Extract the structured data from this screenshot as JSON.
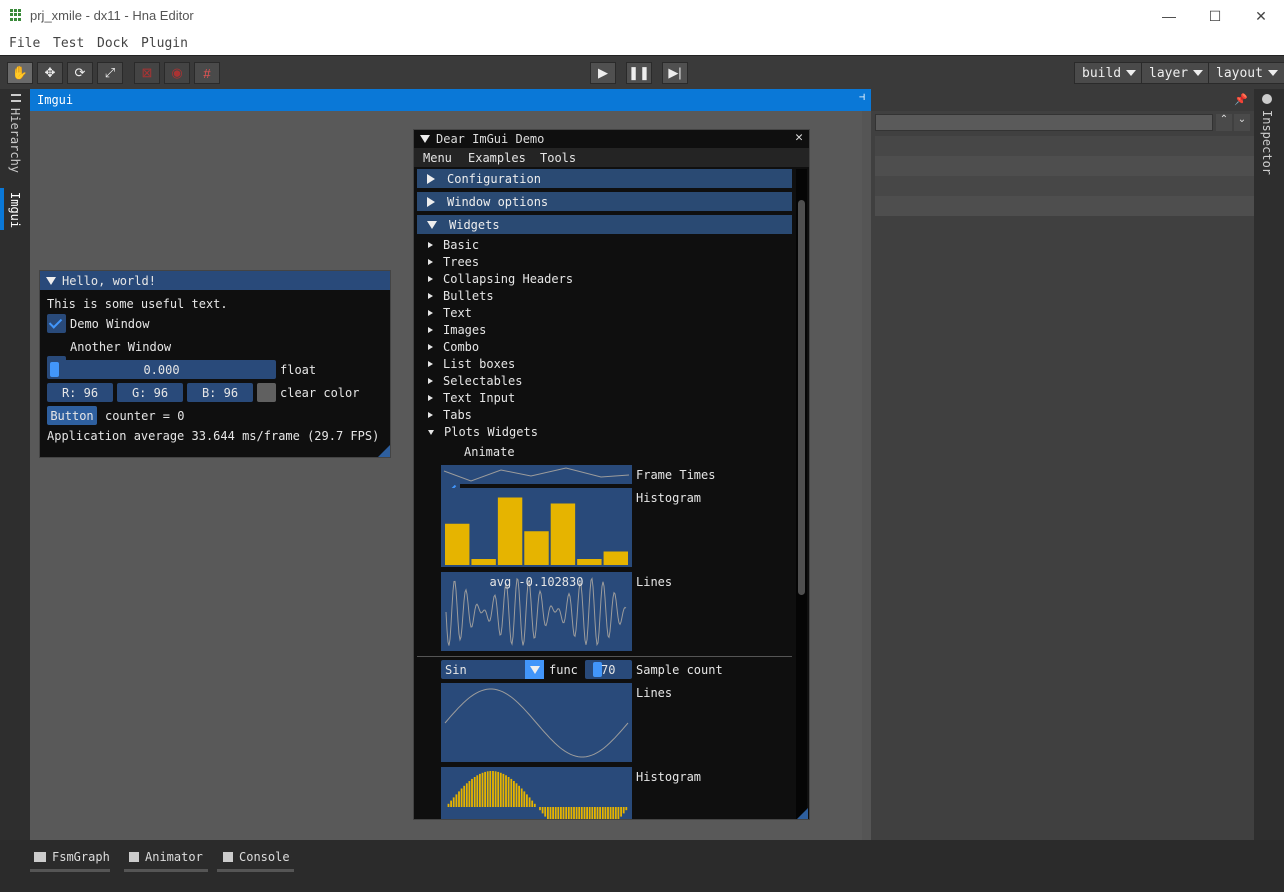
{
  "window": {
    "title": "prj_xmile - dx11 - Hna Editor",
    "minimize": "—",
    "maximize": "☐",
    "close": "✕"
  },
  "menu": [
    "File",
    "Test",
    "Dock",
    "Plugin"
  ],
  "toolbar": {
    "build": "build",
    "layer": "layer",
    "layout": "layout"
  },
  "left_tabs": {
    "hierarchy": "Hierarchy",
    "imgui": "Imgui"
  },
  "right_tabs": {
    "inspector": "Inspector"
  },
  "imgui_panel": {
    "title": "Imgui"
  },
  "hello": {
    "title": "Hello, world!",
    "text": "This is some useful text.",
    "demo_window": "Demo Window",
    "another_window": "Another Window",
    "slider_value": "0.000",
    "slider_label": "float",
    "r": "R: 96",
    "g": "G: 96",
    "b": "B: 96",
    "clear_color": "clear color",
    "button": "Button",
    "counter": "counter = 0",
    "fps": "Application average 33.644 ms/frame (29.7 FPS)"
  },
  "demo": {
    "title": "Dear ImGui Demo",
    "menus": [
      "Menu",
      "Examples",
      "Tools"
    ],
    "headers": [
      "Configuration",
      "Window options",
      "Widgets"
    ],
    "nodes": [
      "Basic",
      "Trees",
      "Collapsing Headers",
      "Bullets",
      "Text",
      "Images",
      "Combo",
      "List boxes",
      "Selectables",
      "Text Input",
      "Tabs",
      "Plots Widgets"
    ],
    "animate": "Animate",
    "frame_times": "Frame Times",
    "histogram": "Histogram",
    "lines": "Lines",
    "avg": "avg -0.102830",
    "func_value": "Sin",
    "func_label": "func",
    "sample_value": "70",
    "sample_label": "Sample count",
    "lines2": "Lines",
    "histogram2": "Histogram"
  },
  "histogram_values": [
    0.55,
    0.08,
    0.9,
    0.45,
    0.82,
    0.08,
    0.18
  ],
  "bottom_tabs": [
    "FsmGraph",
    "Animator",
    "Console"
  ],
  "colors": {
    "accent": "#0a78d7",
    "imgui_frame": "#294a7a",
    "plot_bar": "#e6b400",
    "plot_line": "#9c9c9c"
  }
}
